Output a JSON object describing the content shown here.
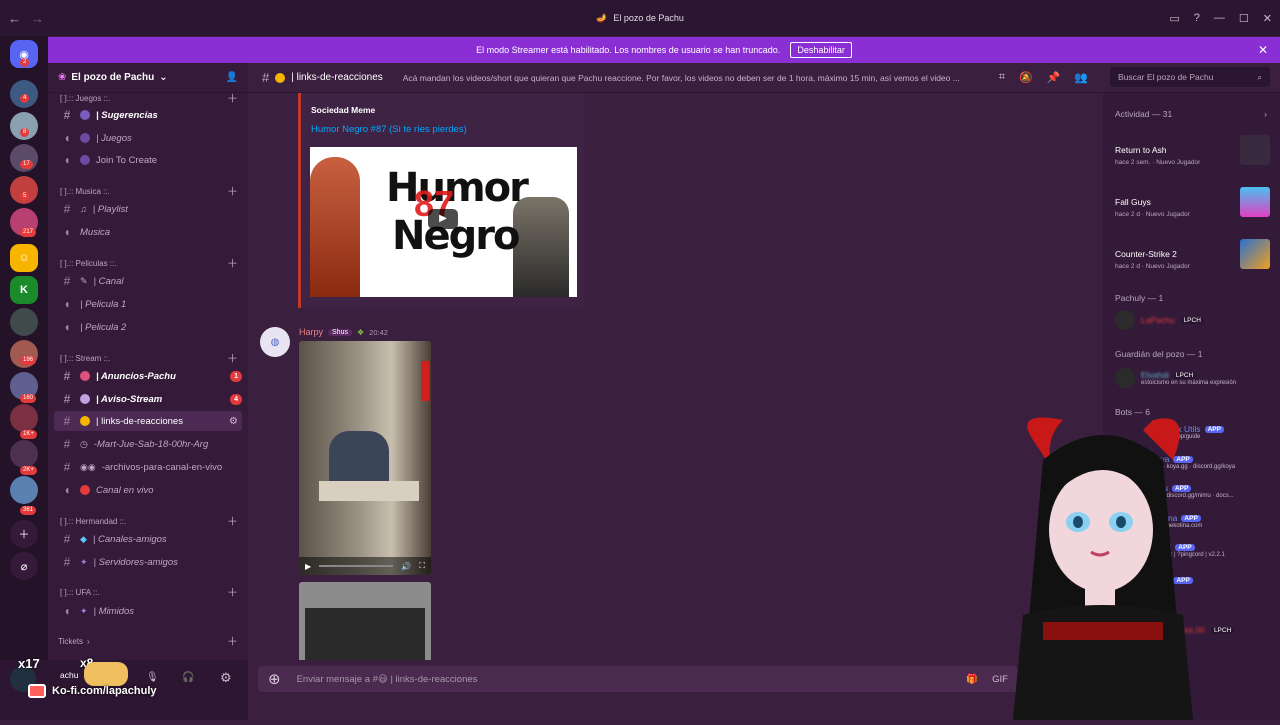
{
  "window": {
    "title": "El pozo de Pachu",
    "controls": [
      "▭",
      "?",
      "—",
      "☐",
      "✕"
    ]
  },
  "banner": {
    "text": "El modo Streamer está habilitado. Los nombres de usuario se han truncado.",
    "button": "Deshabilitar"
  },
  "guilds": {
    "badges": [
      "2",
      "4",
      "8",
      "17",
      "5",
      "217",
      "196",
      "160",
      "1K+",
      "2K+",
      "361"
    ]
  },
  "server": {
    "name": "El pozo de Pachu"
  },
  "categories": [
    {
      "label": "[ ].:: Juegos ::."
    },
    {
      "label": "[ ].:: Musica ::."
    },
    {
      "label": "[ ].:: Peliculas ::."
    },
    {
      "label": "[ ].:: Stream ::."
    },
    {
      "label": "[ ].:: Hermandad ::."
    },
    {
      "label": "[ ].:: UFA ::."
    },
    {
      "label": "Tickets"
    }
  ],
  "channels": [
    {
      "name": "| Sugerencias",
      "count": ""
    },
    {
      "name": "| Juegos",
      "count": ""
    },
    {
      "name": "Join To Create",
      "count": ""
    },
    {
      "name": "| Playlist",
      "count": ""
    },
    {
      "name": "Musica",
      "count": ""
    },
    {
      "name": "| Canal",
      "count": ""
    },
    {
      "name": "| Pelicula 1",
      "count": ""
    },
    {
      "name": "| Pelicula 2",
      "count": ""
    },
    {
      "name": "| Anuncios-Pachu",
      "count": "1"
    },
    {
      "name": "| Aviso-Stream",
      "count": "4"
    },
    {
      "name": "| links-de-reacciones",
      "count": ""
    },
    {
      "name": "-Mart-Jue-Sab-18-00hr-Arg",
      "count": ""
    },
    {
      "name": "-archivos-para-canal-en-vivo",
      "count": ""
    },
    {
      "name": "Canal en vivo",
      "count": ""
    },
    {
      "name": "| Canales-amigos",
      "count": ""
    },
    {
      "name": "| Servidores-amigos",
      "count": ""
    },
    {
      "name": "| Mimidos",
      "count": ""
    }
  ],
  "header": {
    "channel": "| links-de-reacciones",
    "topic": "Acá mandan los videos/short que quieran que Pachu reaccione. Por favor, los videos no deben ser de 1 hora, máximo 15 min, así vemos el video ...",
    "search_placeholder": "Buscar El pozo de Pachu"
  },
  "embed": {
    "provider": "Sociedad Meme",
    "title": "Humor Negro #87 (Si te ríes pierdes)",
    "thumb_text_1": "Humor",
    "thumb_text_2": "Negro",
    "thumb_num": "87"
  },
  "message": {
    "author": "Harpy",
    "role": "Shus",
    "time": "20:42"
  },
  "composer": {
    "placeholder": "Enviar mensaje a #😃 | links-de-reacciones"
  },
  "members": {
    "activity_title": "Actividad — 31",
    "activities": [
      {
        "game": "Return to Ash",
        "sub": "hace 2 sem.",
        "extra": "Nuevo Jugador"
      },
      {
        "game": "Fall Guys",
        "sub": "hace 2 d",
        "extra": "Nuevo Jugador"
      },
      {
        "game": "Counter-Strike 2",
        "sub": "hace 2 d",
        "extra": "Nuevo Jugador"
      }
    ],
    "pachuly_title": "Pachuly — 1",
    "pachuly_name": "LaPachu",
    "badge": "LPCH",
    "guardian_title": "Guardián del pozo — 1",
    "guardian_name": "Elvahdi",
    "guardian_status": "estoicismo en su máxima expresión",
    "bots_title": "Bots — 6",
    "bots": [
      {
        "name": "scohook Utils",
        "sub": "scohook.app/guide"
      },
      {
        "name": "Koya",
        "sub": "help · koya.gg · discord.gg/koya"
      },
      {
        "name": "Jimu",
        "sub": "help · discord.gg/mimu · docs..."
      },
      {
        "name": "ekotina",
        "sub": "help · nekotina.com"
      },
      {
        "name": "gcord",
        "sub": "cord.xyz | ?pingcord | v2.2.1"
      },
      {
        "name": "20",
        "sub": ""
      }
    ],
    "bot_badge": "APP",
    "last_member": "Riot.00"
  },
  "user": {
    "name": "achu"
  },
  "overlay": {
    "kofi": "Ko-fi.com/lapachuly",
    "x17": "x17",
    "x8": "x8"
  }
}
